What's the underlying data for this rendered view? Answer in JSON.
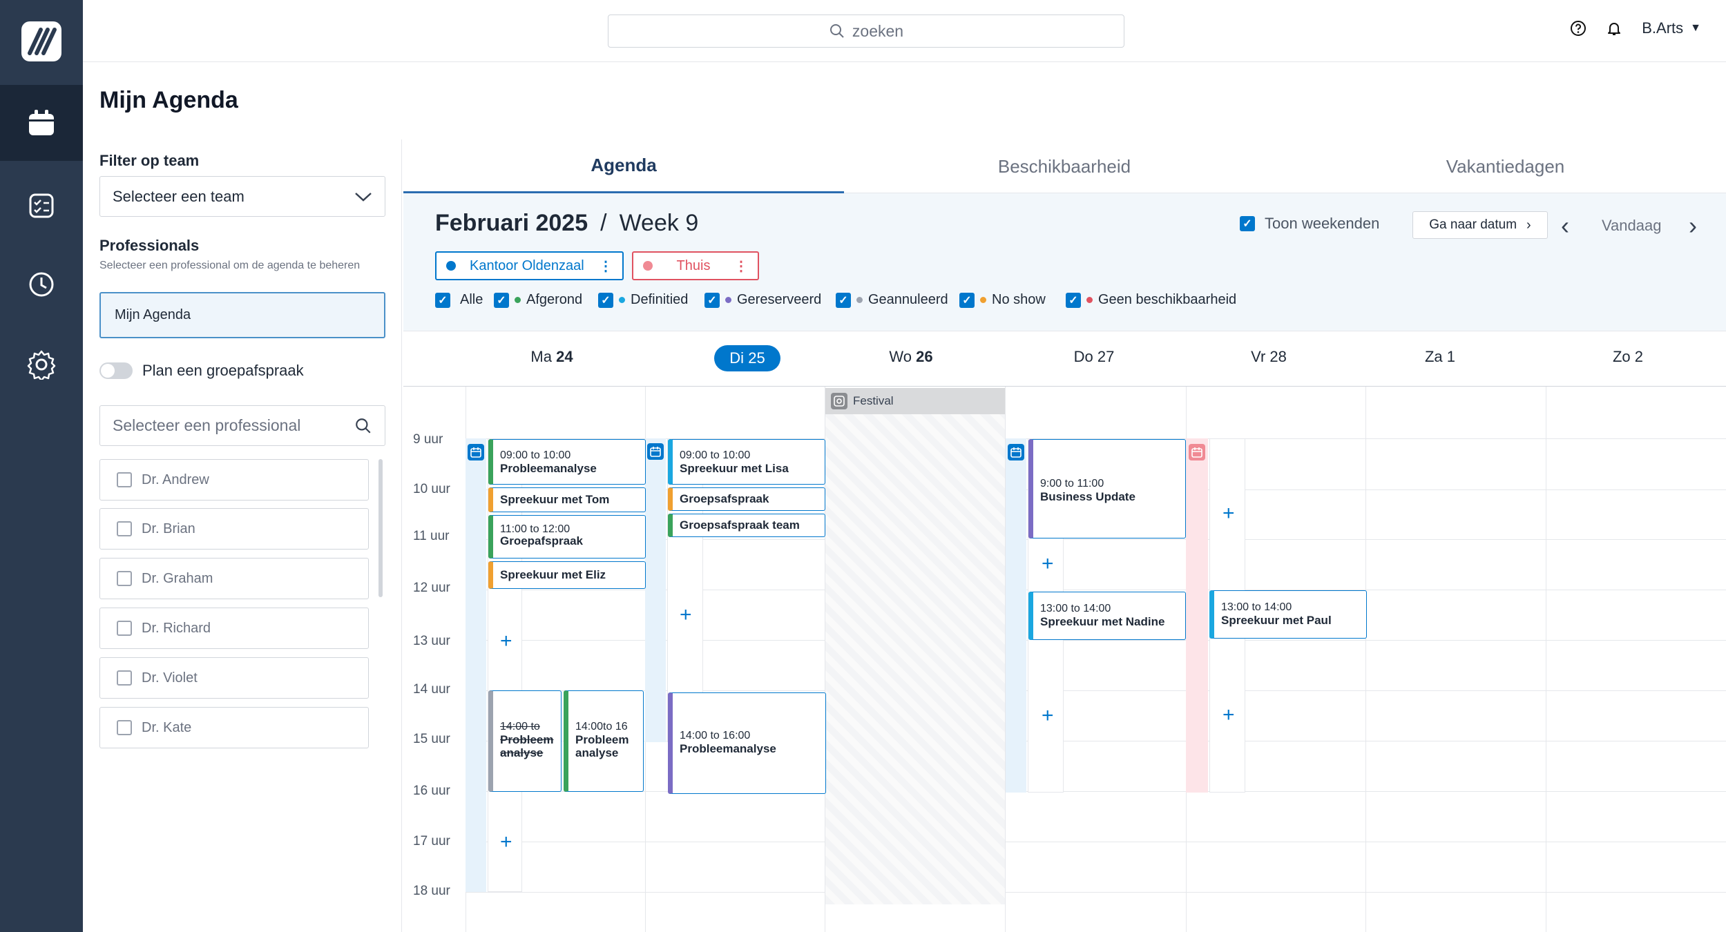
{
  "app": {
    "logo": "logo-icon"
  },
  "rail": {
    "items": [
      {
        "icon": "calendar-icon"
      },
      {
        "icon": "checklist-icon"
      },
      {
        "icon": "clock-icon"
      },
      {
        "icon": "gear-icon"
      }
    ]
  },
  "header": {
    "search_placeholder": "zoeken",
    "user_name": "B.Arts"
  },
  "page": {
    "title": "Mijn Agenda"
  },
  "filters": {
    "team_label": "Filter op team",
    "team_select": "Selecteer een team",
    "professionals_label": "Professionals",
    "professionals_hint": "Selecteer een professional om de agenda te beheren",
    "selected": "Mijn Agenda",
    "group_toggle": "Plan een groepafspraak",
    "search_placeholder": "Selecteer een professional",
    "professionals": [
      "Dr. Andrew",
      "Dr. Brian",
      "Dr. Graham",
      "Dr. Richard",
      "Dr. Violet",
      "Dr. Kate"
    ]
  },
  "tabs": [
    "Agenda",
    "Beschikbaarheid",
    "Vakantiedagen"
  ],
  "calendar": {
    "month": "Februari 2025",
    "separator": "/",
    "week": "Week 9",
    "show_weekends": "Toon weekenden",
    "goto_date": "Ga naar datum",
    "today": "Vandaag",
    "locations": [
      {
        "name": "Kantoor Oldenzaal",
        "color": "#0077cc"
      },
      {
        "name": "Thuis",
        "color": "#e05260"
      }
    ],
    "legend": [
      {
        "label": "Alle",
        "color": ""
      },
      {
        "label": "Afgerond",
        "color": "#3aa35b"
      },
      {
        "label": "Definitied",
        "color": "#1aa7e0"
      },
      {
        "label": "Gereserveerd",
        "color": "#7b6cc4"
      },
      {
        "label": "Geannuleerd",
        "color": "#9ca3af"
      },
      {
        "label": "No show",
        "color": "#f0a030"
      },
      {
        "label": "Geen beschikbaarheid",
        "color": "#e05260"
      }
    ],
    "days": [
      {
        "prefix": "Ma",
        "num": "24"
      },
      {
        "prefix": "Di",
        "num": "25"
      },
      {
        "prefix": "Wo",
        "num": "26"
      },
      {
        "prefix": "Do",
        "num": "27"
      },
      {
        "prefix": "Vr",
        "num": "28"
      },
      {
        "prefix": "Za",
        "num": "1"
      },
      {
        "prefix": "Zo",
        "num": "2"
      }
    ],
    "hours": [
      "9 uur",
      "10 uur",
      "11 uur",
      "12 uur",
      "13 uur",
      "14 uur",
      "15 uur",
      "16 uur",
      "17 uur",
      "18 uur"
    ],
    "allday": {
      "label": "Festival"
    },
    "events": {
      "e1": {
        "time": "09:00 to 10:00",
        "title": "Probleemanalyse"
      },
      "e2": {
        "title": "Spreekuur met Tom"
      },
      "e3": {
        "time": "11:00 to 12:00",
        "title": "Groepafspraak"
      },
      "e4": {
        "title": "Spreekuur met Eliz"
      },
      "e5": {
        "time": "14:00 to",
        "title": "Probleem analyse"
      },
      "e6": {
        "time": "14:00to 16",
        "title": "Probleem analyse"
      },
      "e7": {
        "time": "09:00 to 10:00",
        "title": "Spreekuur met Lisa"
      },
      "e8": {
        "title": "Groepsafspraak"
      },
      "e9": {
        "title": "Groepsafspraak team"
      },
      "e10": {
        "time": "14:00 to 16:00",
        "title": "Probleemanalyse"
      },
      "e11": {
        "time": "9:00 to 11:00",
        "title": "Business Update"
      },
      "e12": {
        "time": "13:00 to 14:00",
        "title": "Spreekuur met Nadine"
      },
      "e13": {
        "time": "13:00 to 14:00",
        "title": "Spreekuur met Paul"
      }
    }
  }
}
